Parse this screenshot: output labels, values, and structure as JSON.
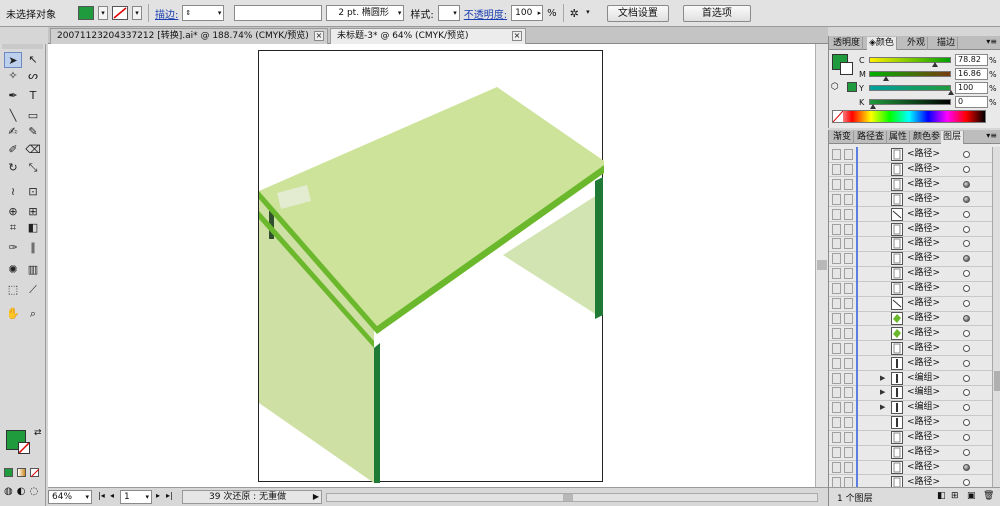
{
  "control_bar": {
    "selection_status": "未选择对象",
    "stroke_label": "描边:",
    "brush_value": "2 pt. 椭圆形",
    "style_label": "样式:",
    "opacity_label": "不透明度:",
    "opacity_value": "100",
    "opacity_unit": "%",
    "doc_setup_button": "文档设置",
    "prefs_button": "首选项",
    "fill_color": "#1f9a3c"
  },
  "document_tabs": [
    {
      "label": "20071123204337212 [转换].ai* @ 188.74% (CMYK/预览)",
      "active": false
    },
    {
      "label": "未标题-3* @ 64% (CMYK/预览)",
      "active": true
    }
  ],
  "color_panel": {
    "tabs": [
      "透明度",
      "颜色",
      "外观",
      "描边"
    ],
    "active_tab": "颜色",
    "channels": [
      {
        "name": "C",
        "value": "78.82",
        "fraction": 0.79
      },
      {
        "name": "M",
        "value": "16.86",
        "fraction": 0.17
      },
      {
        "name": "Y",
        "value": "100",
        "fraction": 1.0
      },
      {
        "name": "K",
        "value": "0",
        "fraction": 0.0
      }
    ],
    "percent_sign": "%"
  },
  "layers_panel": {
    "tabs": [
      "渐变",
      "路径查",
      "属性",
      "颜色参",
      "图层"
    ],
    "active_tab": "图层",
    "items": [
      {
        "name": "<路径>",
        "filled": false,
        "expandable": false,
        "thumb": "rect"
      },
      {
        "name": "<路径>",
        "filled": false,
        "expandable": false,
        "thumb": "rect"
      },
      {
        "name": "<路径>",
        "filled": true,
        "expandable": false,
        "thumb": "rect"
      },
      {
        "name": "<路径>",
        "filled": true,
        "expandable": false,
        "thumb": "rect"
      },
      {
        "name": "<路径>",
        "filled": false,
        "expandable": false,
        "thumb": "line"
      },
      {
        "name": "<路径>",
        "filled": false,
        "expandable": false,
        "thumb": "rect"
      },
      {
        "name": "<路径>",
        "filled": false,
        "expandable": false,
        "thumb": "rect"
      },
      {
        "name": "<路径>",
        "filled": true,
        "expandable": false,
        "thumb": "rect"
      },
      {
        "name": "<路径>",
        "filled": false,
        "expandable": false,
        "thumb": "rect"
      },
      {
        "name": "<路径>",
        "filled": false,
        "expandable": false,
        "thumb": "rect"
      },
      {
        "name": "<路径>",
        "filled": false,
        "expandable": false,
        "thumb": "line"
      },
      {
        "name": "<路径>",
        "filled": true,
        "expandable": false,
        "thumb": "green"
      },
      {
        "name": "<路径>",
        "filled": false,
        "expandable": false,
        "thumb": "green"
      },
      {
        "name": "<路径>",
        "filled": false,
        "expandable": false,
        "thumb": "rect"
      },
      {
        "name": "<路径>",
        "filled": false,
        "expandable": false,
        "thumb": "bar"
      },
      {
        "name": "<编组>",
        "filled": false,
        "expandable": true,
        "thumb": "bar"
      },
      {
        "name": "<编组>",
        "filled": false,
        "expandable": true,
        "thumb": "bar"
      },
      {
        "name": "<编组>",
        "filled": false,
        "expandable": true,
        "thumb": "bar"
      },
      {
        "name": "<路径>",
        "filled": false,
        "expandable": false,
        "thumb": "bar"
      },
      {
        "name": "<路径>",
        "filled": false,
        "expandable": false,
        "thumb": "rect"
      },
      {
        "name": "<路径>",
        "filled": false,
        "expandable": false,
        "thumb": "rect"
      },
      {
        "name": "<路径>",
        "filled": true,
        "expandable": false,
        "thumb": "rect"
      },
      {
        "name": "<路径>",
        "filled": false,
        "expandable": false,
        "thumb": "rect"
      }
    ],
    "footer_count": "1 个图层"
  },
  "status_bar": {
    "zoom": "64%",
    "artboard_number": "1",
    "undo_status": "39 次还原 : 无重做"
  },
  "tools": [
    "selection-tool",
    "direct-selection-tool",
    "magic-wand-tool",
    "lasso-tool",
    "pen-tool",
    "type-tool",
    "line-tool",
    "rectangle-tool",
    "paintbrush-tool",
    "pencil-tool",
    "blob-brush-tool",
    "eraser-tool",
    "rotate-tool",
    "scale-tool",
    "warp-tool",
    "free-transform-tool",
    "shape-builder-tool",
    "perspective-grid-tool",
    "mesh-tool",
    "gradient-tool",
    "eyedropper-tool",
    "measure-tool",
    "symbol-sprayer-tool",
    "column-graph-tool",
    "artboard-tool",
    "slice-tool",
    "hand-tool",
    "zoom-tool"
  ]
}
